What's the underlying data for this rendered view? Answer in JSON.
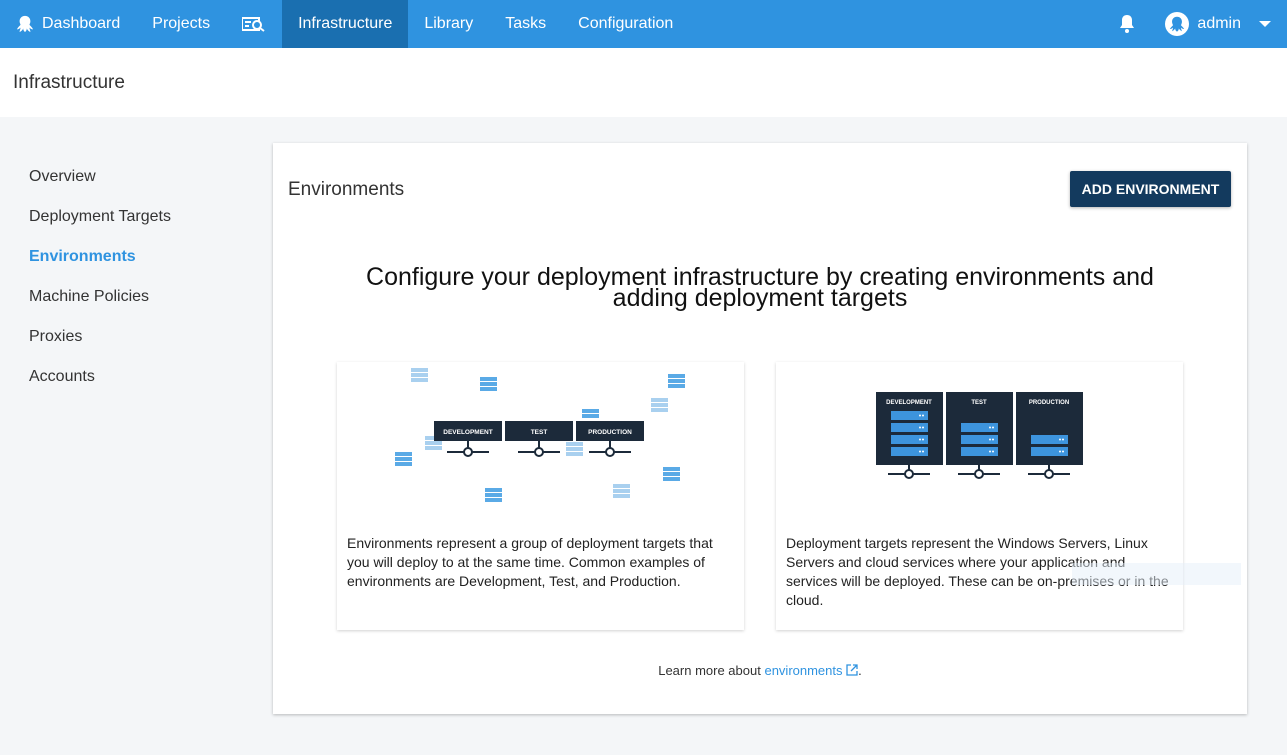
{
  "nav": {
    "items": [
      {
        "label": "Dashboard",
        "icon": "octopus-icon"
      },
      {
        "label": "Projects"
      },
      {
        "label": "",
        "icon": "search-icon"
      },
      {
        "label": "Infrastructure",
        "active": true
      },
      {
        "label": "Library"
      },
      {
        "label": "Tasks"
      },
      {
        "label": "Configuration"
      }
    ],
    "user": "admin",
    "bell_icon": "bell-icon",
    "accent": "#2f93e0",
    "active_bg": "#1a6fb0"
  },
  "page": {
    "title": "Infrastructure"
  },
  "sidebar": {
    "items": [
      {
        "label": "Overview"
      },
      {
        "label": "Deployment Targets"
      },
      {
        "label": "Environments",
        "active": true
      },
      {
        "label": "Machine Policies"
      },
      {
        "label": "Proxies"
      },
      {
        "label": "Accounts"
      }
    ]
  },
  "panel": {
    "title": "Environments",
    "add_button": "ADD ENVIRONMENT",
    "headline_line1": "Configure your deployment infrastructure by creating environments and",
    "headline_line2": "adding deployment targets",
    "card1": {
      "text": "Environments represent a group of deployment targets that you will deploy to at the same time. Common examples of environments are Development, Test, and Production.",
      "labels": [
        "DEVELOPMENT",
        "TEST",
        "PRODUCTION"
      ]
    },
    "card2": {
      "text": "Deployment targets represent the Windows Servers, Linux Servers and cloud services where your application and services will be deployed. These can be on-premises or in the cloud.",
      "labels": [
        "DEVELOPMENT",
        "TEST",
        "PRODUCTION"
      ]
    },
    "learn_prefix": "Learn more about",
    "learn_link": "environments",
    "learn_suffix": "."
  }
}
